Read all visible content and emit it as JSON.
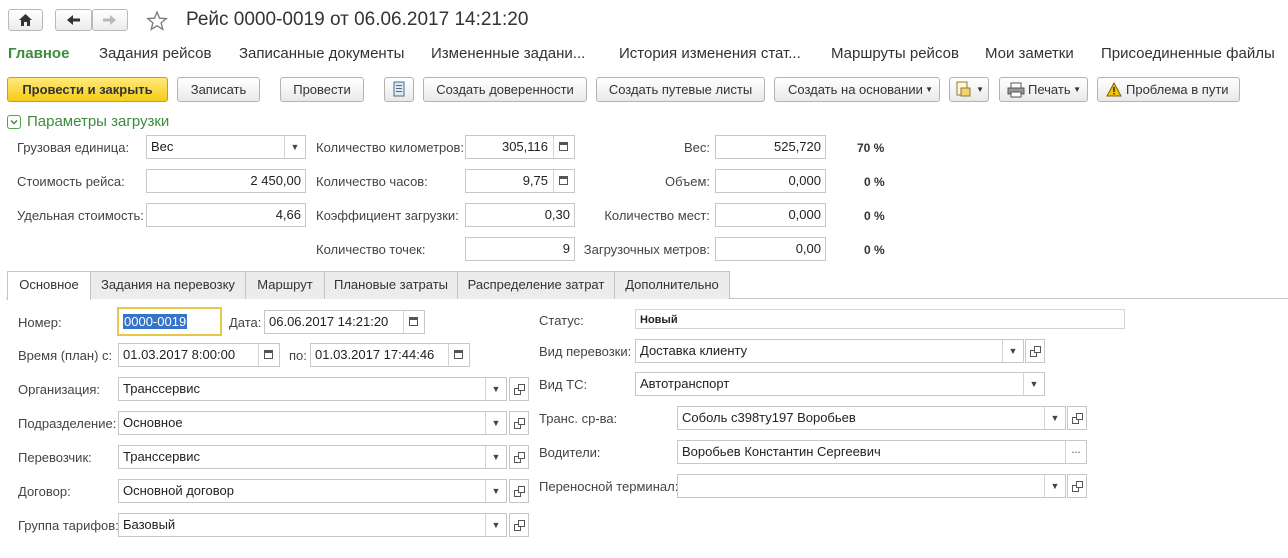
{
  "header": {
    "title": "Рейс 0000-0019 от 06.06.2017 14:21:20"
  },
  "section_links": [
    "Главное",
    "Задания рейсов",
    "Записанные документы",
    "Измененные задани...",
    "История изменения стат...",
    "Маршруты рейсов",
    "Мои заметки",
    "Присоединенные файлы"
  ],
  "toolbar": {
    "post_close": "Провести и закрыть",
    "save": "Записать",
    "post": "Провести",
    "create_powers": "Создать доверенности",
    "create_waybills": "Создать путевые листы",
    "create_based": "Создать на основании",
    "print": "Печать",
    "problem": "Проблема в пути"
  },
  "params": {
    "group_title": "Параметры загрузки",
    "cargo_unit_label": "Грузовая единица:",
    "cargo_unit_value": "Вес",
    "trip_cost_label": "Стоимость рейса:",
    "trip_cost_value": "2 450,00",
    "unit_cost_label": "Удельная стоимость:",
    "unit_cost_value": "4,66",
    "km_label": "Количество километров:",
    "km_value": "305,116",
    "hours_label": "Количество часов:",
    "hours_value": "9,75",
    "load_coef_label": "Коэффициент загрузки:",
    "load_coef_value": "0,30",
    "points_label": "Количество точек:",
    "points_value": "9",
    "weight_label": "Вес:",
    "weight_value": "525,720",
    "weight_pct": "70  %",
    "volume_label": "Объем:",
    "volume_value": "0,000",
    "volume_pct": "0  %",
    "places_label": "Количество мест:",
    "places_value": "0,000",
    "places_pct": "0  %",
    "meters_label": "Загрузочных метров:",
    "meters_value": "0,00",
    "meters_pct": "0  %"
  },
  "tabs": [
    "Основное",
    "Задания на перевозку",
    "Маршрут",
    "Плановые затраты",
    "Распределение затрат",
    "Дополнительно"
  ],
  "main": {
    "number_label": "Номер:",
    "number_value": "0000-0019",
    "date_label": "Дата:",
    "date_value": "06.06.2017 14:21:20",
    "time_plan_label": "Время (план) с:",
    "time_from": "01.03.2017  8:00:00",
    "to_label": "по:",
    "time_to": "01.03.2017 17:44:46",
    "org_label": "Организация:",
    "org_value": "Транссервис",
    "dept_label": "Подразделение:",
    "dept_value": "Основное",
    "carrier_label": "Перевозчик:",
    "carrier_value": "Транссервис",
    "contract_label": "Договор:",
    "contract_value": "Основной договор",
    "tariff_label": "Группа тарифов:",
    "tariff_value": "Базовый",
    "status_label": "Статус:",
    "status_value": "Новый",
    "transport_kind_label": "Вид перевозки:",
    "transport_kind_value": "Доставка клиенту",
    "vehicle_kind_label": "Вид ТС:",
    "vehicle_kind_value": "Автотранспорт",
    "vehicles_label": "Транс. ср-ва:",
    "vehicles_value": "Соболь с398ту197 Воробьев",
    "drivers_label": "Водители:",
    "drivers_value": "Воробьев Константин Сергеевич",
    "terminal_label": "Переносной терминал:",
    "terminal_value": ""
  }
}
